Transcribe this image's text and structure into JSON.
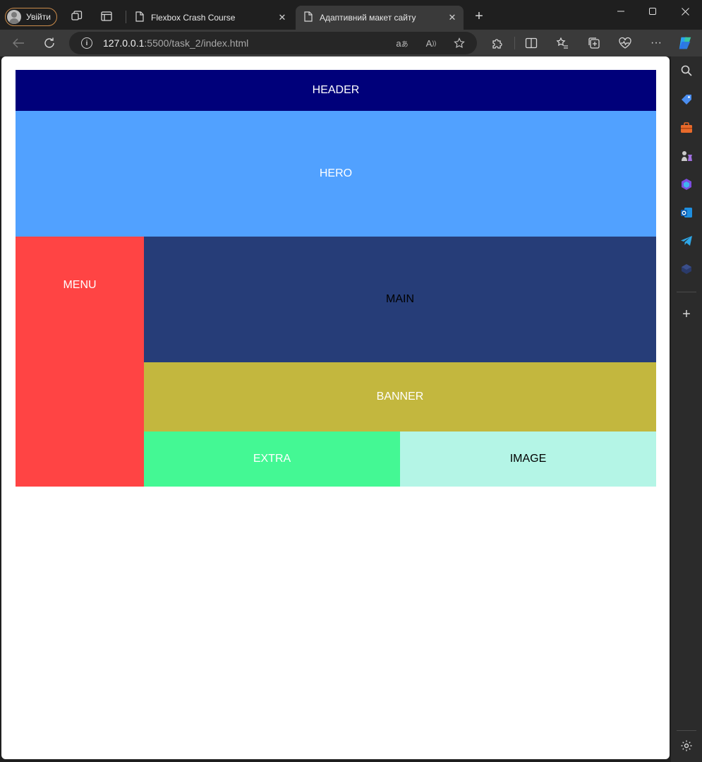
{
  "browser": {
    "profile_label": "Увійти",
    "tabs": [
      {
        "label": "Flexbox Crash Course",
        "active": false
      },
      {
        "label": "Адаптивний макет сайту",
        "active": true
      }
    ],
    "address": {
      "host": "127.0.0.1",
      "rest": ":5500/task_2/index.html"
    },
    "icons": {
      "workspaces": "workspaces-icon",
      "tab_actions": "tab-actions-icon",
      "new_tab": "plus-icon",
      "minimize": "minimize-icon",
      "maximize": "maximize-icon",
      "close": "close-icon",
      "back": "back-arrow-icon",
      "refresh": "refresh-icon",
      "site_info": "info-icon",
      "translate": "translate-icon",
      "read_aloud": "read-aloud-icon",
      "favorite": "star-icon",
      "extensions": "puzzle-icon",
      "split_screen": "split-screen-icon",
      "favorites": "favorites-icon",
      "collections": "collections-icon",
      "performance": "heartbeat-icon",
      "more": "more-icon",
      "copilot": "copilot-icon"
    }
  },
  "sidebar": {
    "items": [
      "search-icon",
      "tag-icon",
      "toolbox-icon",
      "chess-icon",
      "m365-icon",
      "outlook-icon",
      "telegram-icon",
      "cube-icon",
      "add-icon",
      "settings-icon"
    ]
  },
  "page": {
    "blocks": [
      {
        "name": "header",
        "label": "HEADER",
        "bg": "#00007a",
        "fg": "#ffffff"
      },
      {
        "name": "hero",
        "label": "HERO",
        "bg": "#51a1ff",
        "fg": "#ffffff"
      },
      {
        "name": "menu",
        "label": "MENU",
        "bg": "#ff4444",
        "fg": "#ffffff"
      },
      {
        "name": "main",
        "label": "MAIN",
        "bg": "#263d78",
        "fg": "#000000"
      },
      {
        "name": "banner",
        "label": "BANNER",
        "bg": "#c3b73e",
        "fg": "#ffffff"
      },
      {
        "name": "extra",
        "label": "EXTRA",
        "bg": "#44f894",
        "fg": "#ffffff"
      },
      {
        "name": "image",
        "label": "IMAGE",
        "bg": "#b4f5e6",
        "fg": "#000000"
      }
    ]
  }
}
